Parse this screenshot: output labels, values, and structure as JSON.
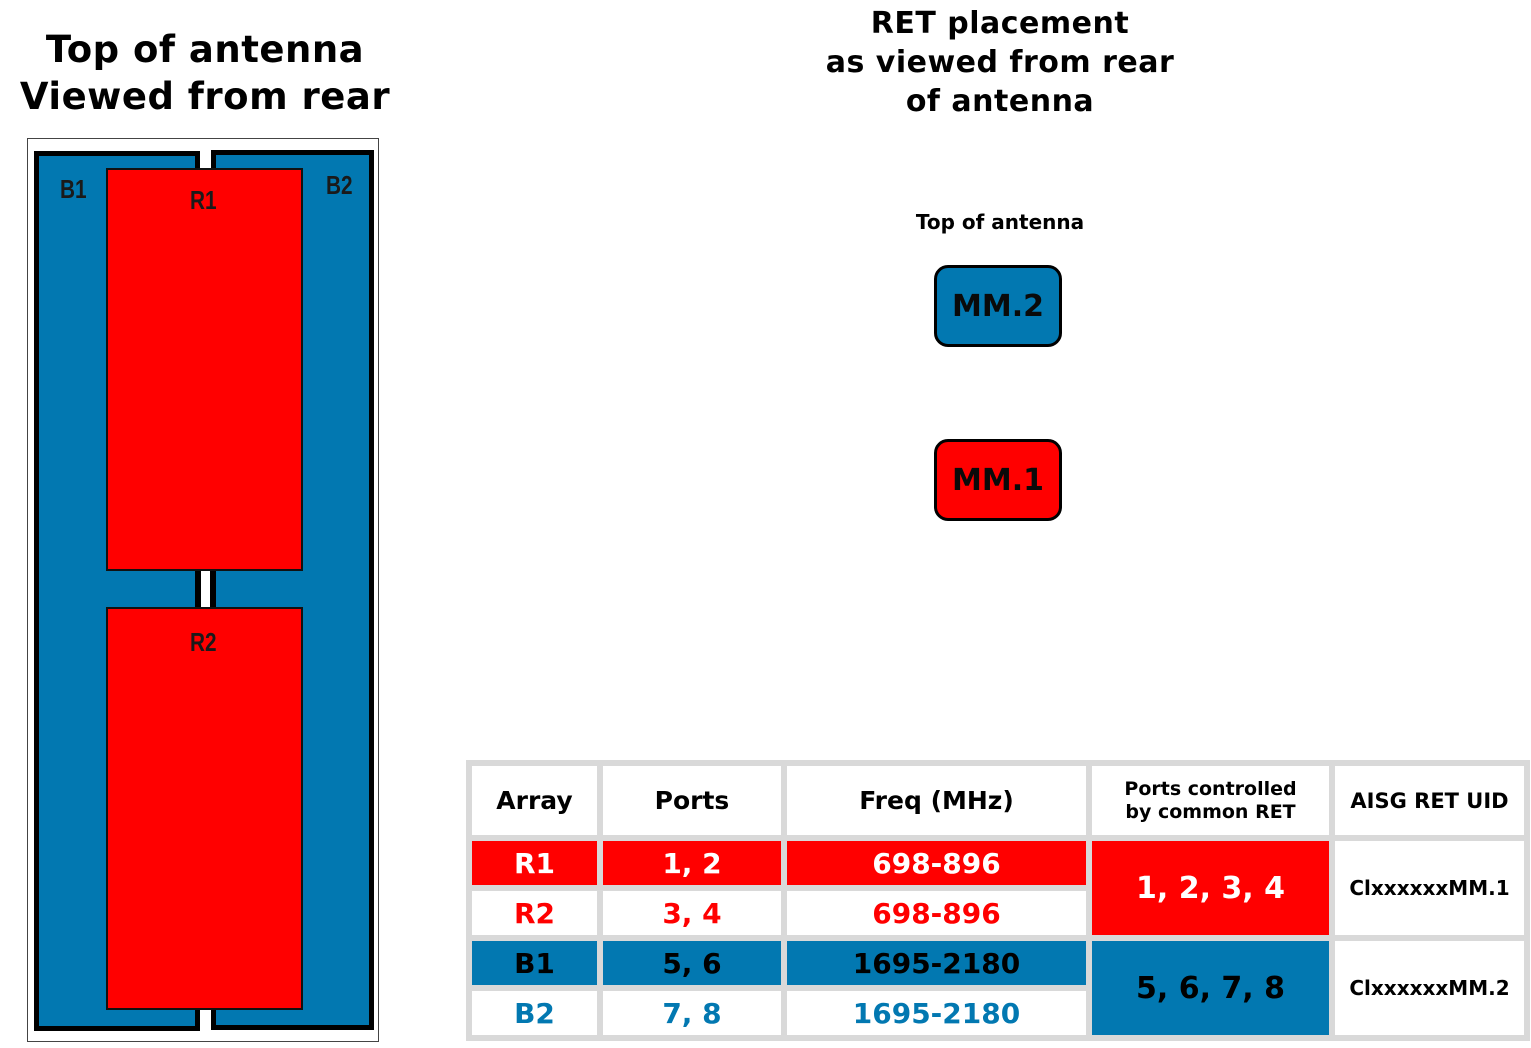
{
  "left_title": [
    "Top of antenna",
    "Viewed from rear"
  ],
  "right_title": [
    "RET placement",
    "as viewed from rear",
    "of antenna"
  ],
  "top_of_antenna_label": "Top of antenna",
  "colors": {
    "blue": "#0278b1",
    "red": "#ff0000"
  },
  "antenna_diagram": {
    "arrays": [
      {
        "id": "B1",
        "color": "blue",
        "position": "left"
      },
      {
        "id": "B2",
        "color": "blue",
        "position": "right"
      },
      {
        "id": "R1",
        "color": "red",
        "position": "center-top"
      },
      {
        "id": "R2",
        "color": "red",
        "position": "center-bottom"
      }
    ]
  },
  "ret_units": [
    {
      "label": "MM.2",
      "color": "blue"
    },
    {
      "label": "MM.1",
      "color": "red"
    }
  ],
  "table": {
    "headers": [
      "Array",
      "Ports",
      "Freq (MHz)",
      "Ports controlled by common RET",
      "AISG RET UID"
    ],
    "headers_lines": {
      "controlled_line1": "Ports controlled",
      "controlled_line2": "by common RET"
    },
    "rows": [
      {
        "array": "R1",
        "ports": "1, 2",
        "freq": "698-896"
      },
      {
        "array": "R2",
        "ports": "3, 4",
        "freq": "698-896"
      },
      {
        "array": "B1",
        "ports": "5, 6",
        "freq": "1695-2180"
      },
      {
        "array": "B2",
        "ports": "7, 8",
        "freq": "1695-2180"
      }
    ],
    "groups": [
      {
        "ports_controlled": "1, 2, 3, 4",
        "uid": "ClxxxxxxMM.1"
      },
      {
        "ports_controlled": "5, 6, 7, 8",
        "uid": "ClxxxxxxMM.2"
      }
    ]
  }
}
